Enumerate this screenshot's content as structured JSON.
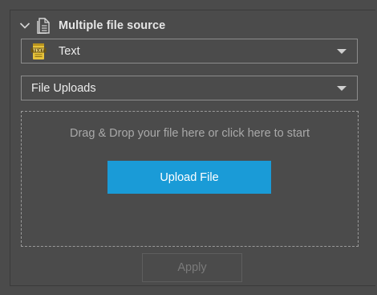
{
  "section": {
    "title": "Multiple file source",
    "collapse_icon": "chevron-down-icon",
    "section_icon": "document-icon"
  },
  "type_select": {
    "value": "Text",
    "icon": "text-file-icon",
    "icon_text": "TEXT"
  },
  "source_select": {
    "value": "File Uploads"
  },
  "dropzone": {
    "prompt": "Drag & Drop your file here or click here to start",
    "upload_label": "Upload File"
  },
  "apply_label": "Apply",
  "colors": {
    "background": "#4b4b4b",
    "accent": "#1a9bd7",
    "text": "#e6e6e6",
    "muted_text": "#a9a9a9",
    "disabled_text": "#7a7a7a"
  }
}
